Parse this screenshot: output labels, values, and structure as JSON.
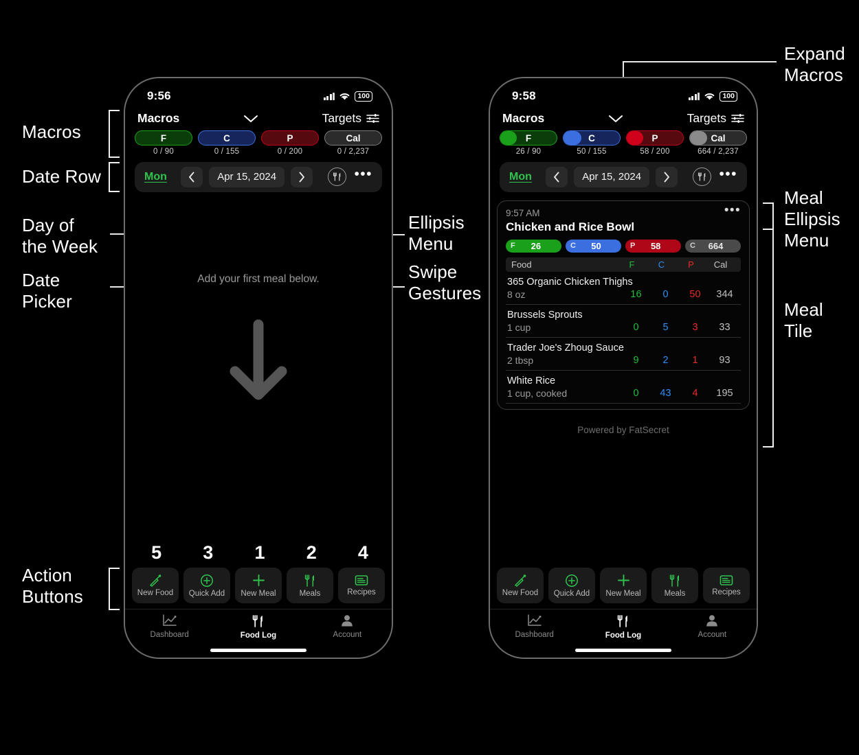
{
  "annotations": {
    "macros": "Macros",
    "date_row": "Date Row",
    "day_of_week": "Day of\nthe Week",
    "date_picker": "Date\nPicker",
    "action_buttons": "Action\nButtons",
    "ellipsis_menu": "Ellipsis\nMenu",
    "swipe_gestures": "Swipe\nGestures",
    "expand_macros": "Expand\nMacros",
    "meal_ellipsis_menu": "Meal\nEllipsis\nMenu",
    "meal_tile": "Meal\nTile"
  },
  "colors": {
    "fat": "#1aa01a",
    "carb": "#3b6fe0",
    "protein": "#d0021b",
    "cal": "#8a8a8a",
    "accent_green": "#2fc24d",
    "fat_dark": "#0b3d0b",
    "carb_dark": "#16255c",
    "protein_dark": "#560a0f",
    "cal_dark": "#2b2b2b"
  },
  "left_phone": {
    "status": {
      "time": "9:56",
      "battery": "100",
      "wifi_icon": "wifi-icon",
      "signal_icon": "cellular-icon"
    },
    "header": {
      "title": "Macros",
      "chevron_icon": "chevron-down-icon",
      "targets_label": "Targets",
      "targets_icon": "sliders-icon"
    },
    "macro_pills": [
      {
        "key": "F",
        "value": "0 / 90",
        "progress": 0,
        "color": "#1aa01a",
        "track": "#0b3d0b",
        "label_color": "#ffffff",
        "num_color": "#ffffff",
        "goal_color": "#2fc24d"
      },
      {
        "key": "C",
        "value": "0 / 155",
        "progress": 0,
        "color": "#3b6fe0",
        "track": "#16255c",
        "label_color": "#ffffff",
        "num_color": "#ffffff",
        "goal_color": "#3b8fe0"
      },
      {
        "key": "P",
        "value": "0 / 200",
        "progress": 0,
        "color": "#d0021b",
        "track": "#560a0f",
        "label_color": "#ffffff",
        "num_color": "#ffffff",
        "goal_color": "#e02020"
      },
      {
        "key": "Cal",
        "value": "0 / 2,237",
        "progress": 0,
        "color": "#8a8a8a",
        "track": "#2b2b2b",
        "label_color": "#ffffff",
        "num_color": "#cfcfcf",
        "goal_color": "#cfcfcf"
      }
    ],
    "date_row": {
      "day_of_week": "Mon",
      "prev_icon": "chevron-left-icon",
      "date": "Apr 15, 2024",
      "next_icon": "chevron-right-icon",
      "meal_icon": "utensils-circle-icon",
      "ellipsis_icon": "ellipsis-icon"
    },
    "empty_state": {
      "text": "Add your first meal below.",
      "arrow_icon": "arrow-down-icon"
    },
    "action_numbers": [
      "5",
      "3",
      "1",
      "2",
      "4"
    ],
    "actions": [
      {
        "label": "New Food",
        "icon": "carrot-icon"
      },
      {
        "label": "Quick Add",
        "icon": "plus-circle-icon"
      },
      {
        "label": "New Meal",
        "icon": "plus-icon"
      },
      {
        "label": "Meals",
        "icon": "utensils-icon"
      },
      {
        "label": "Recipes",
        "icon": "recipe-card-icon"
      }
    ],
    "tabs": [
      {
        "label": "Dashboard",
        "icon": "chart-icon",
        "active": false
      },
      {
        "label": "Food Log",
        "icon": "utensils-icon",
        "active": true
      },
      {
        "label": "Account",
        "icon": "person-icon",
        "active": false
      }
    ]
  },
  "right_phone": {
    "status": {
      "time": "9:58",
      "battery": "100",
      "wifi_icon": "wifi-icon",
      "signal_icon": "cellular-icon"
    },
    "header": {
      "title": "Macros",
      "chevron_icon": "chevron-down-icon",
      "targets_label": "Targets",
      "targets_icon": "sliders-icon"
    },
    "macro_pills": [
      {
        "key": "F",
        "value": "26 / 90",
        "progress": 29,
        "color": "#1aa01a",
        "track": "#0b3d0b",
        "goal_color": "#2fc24d"
      },
      {
        "key": "C",
        "value": "50 / 155",
        "progress": 32,
        "color": "#3b6fe0",
        "track": "#16255c",
        "goal_color": "#3b8fe0"
      },
      {
        "key": "P",
        "value": "58 / 200",
        "progress": 29,
        "color": "#d0021b",
        "track": "#560a0f",
        "goal_color": "#e02020"
      },
      {
        "key": "Cal",
        "value": "664 / 2,237",
        "progress": 30,
        "color": "#8a8a8a",
        "track": "#2b2b2b",
        "goal_color": "#cfcfcf"
      }
    ],
    "date_row": {
      "day_of_week": "Mon",
      "prev_icon": "chevron-left-icon",
      "date": "Apr 15, 2024",
      "next_icon": "chevron-right-icon",
      "meal_icon": "utensils-circle-icon",
      "ellipsis_icon": "ellipsis-icon"
    },
    "meal_tile": {
      "time": "9:57 AM",
      "ellipsis_icon": "ellipsis-icon",
      "name": "Chicken and Rice Bowl",
      "totals": [
        {
          "key": "F",
          "value": "26",
          "color": "#1aa01a"
        },
        {
          "key": "C",
          "value": "50",
          "color": "#3b6fe0"
        },
        {
          "key": "P",
          "value": "58",
          "color": "#d0021b"
        },
        {
          "key": "C",
          "value": "664",
          "color": "#6a6a6a"
        }
      ],
      "columns": {
        "food": "Food",
        "f": "F",
        "c": "C",
        "p": "P",
        "cal": "Cal"
      },
      "foods": [
        {
          "name": "365 Organic Chicken Thighs",
          "serving": "8 oz",
          "f": "16",
          "c": "0",
          "p": "50",
          "cal": "344"
        },
        {
          "name": "Brussels Sprouts",
          "serving": "1 cup",
          "f": "0",
          "c": "5",
          "p": "3",
          "cal": "33"
        },
        {
          "name": "Trader Joe's Zhoug Sauce",
          "serving": "2 tbsp",
          "f": "9",
          "c": "2",
          "p": "1",
          "cal": "93"
        },
        {
          "name": "White Rice",
          "serving": "1 cup, cooked",
          "f": "0",
          "c": "43",
          "p": "4",
          "cal": "195"
        }
      ]
    },
    "powered_by": "Powered by FatSecret",
    "actions": [
      {
        "label": "New Food",
        "icon": "carrot-icon"
      },
      {
        "label": "Quick Add",
        "icon": "plus-circle-icon"
      },
      {
        "label": "New Meal",
        "icon": "plus-icon"
      },
      {
        "label": "Meals",
        "icon": "utensils-icon"
      },
      {
        "label": "Recipes",
        "icon": "recipe-card-icon"
      }
    ],
    "tabs": [
      {
        "label": "Dashboard",
        "icon": "chart-icon",
        "active": false
      },
      {
        "label": "Food Log",
        "icon": "utensils-icon",
        "active": true
      },
      {
        "label": "Account",
        "icon": "person-icon",
        "active": false
      }
    ]
  }
}
